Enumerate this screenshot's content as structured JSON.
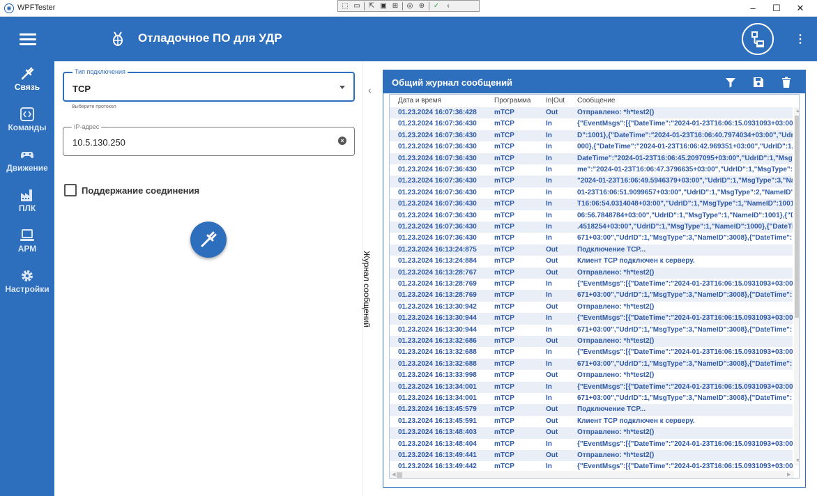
{
  "window": {
    "title": "WPFTester",
    "minimize": "–",
    "maximize": "☐",
    "close": "✕"
  },
  "debug_toolbar": {
    "icons": [
      "select-icon",
      "camera-icon",
      "pointer-icon",
      "box-icon",
      "layout-icon",
      "track-icon",
      "accessibility-icon",
      "check-icon",
      "collapse-icon"
    ]
  },
  "appbar": {
    "title": "Отладочное ПО для УДР",
    "more": "⋮"
  },
  "nav": [
    {
      "label": "Связь",
      "icon": "plug-icon",
      "active": true
    },
    {
      "label": "Команды",
      "icon": "code-icon"
    },
    {
      "label": "Движение",
      "icon": "gamepad-icon"
    },
    {
      "label": "ПЛК",
      "icon": "factory-icon"
    },
    {
      "label": "АРМ",
      "icon": "laptop-icon"
    },
    {
      "label": "Настройки",
      "icon": "gear-icon"
    }
  ],
  "connection": {
    "type_label": "Тип подключения",
    "type_value": "TCP",
    "type_hint": "Выберите протокол",
    "ip_label": "IP-адрес",
    "ip_value": "10.5.130.250",
    "keepalive_label": "Поддержание соединения",
    "keepalive_checked": false
  },
  "side_tab": {
    "label": "Журнал сообщений"
  },
  "log": {
    "title": "Общий журнал сообщений",
    "columns": [
      "Дата и время",
      "Программа",
      "In|Out",
      "Сообщение"
    ],
    "rows": [
      [
        "01.23.2024 16:07:36:428",
        "mTCP",
        "Out",
        "Отправлено: *h*test2()"
      ],
      [
        "01.23.2024 16:07:36:430",
        "mTCP",
        "In",
        "{\"EventMsgs\":[{\"DateTime\":\"2024-01-23T16:06:15.0931093+03:00\",\"U"
      ],
      [
        "01.23.2024 16:07:36:430",
        "mTCP",
        "In",
        "D\":1001},{\"DateTime\":\"2024-01-23T16:06:40.7974034+03:00\",\"UdrID\":"
      ],
      [
        "01.23.2024 16:07:36:430",
        "mTCP",
        "In",
        "000},{\"DateTime\":\"2024-01-23T16:06:42.969351+03:00\",\"UdrID\":1,\"Ms"
      ],
      [
        "01.23.2024 16:07:36:430",
        "mTCP",
        "In",
        "DateTime\":\"2024-01-23T16:06:45.2097095+03:00\",\"UdrID\":1,\"MsgTyp"
      ],
      [
        "01.23.2024 16:07:36:430",
        "mTCP",
        "In",
        "me\":\"2024-01-23T16:06:47.3796635+03:00\",\"UdrID\":1,\"MsgType\":4,\"N"
      ],
      [
        "01.23.2024 16:07:36:430",
        "mTCP",
        "In",
        "\"2024-01-23T16:06:49.5946379+03:00\",\"UdrID\":1,\"MsgType\":3,\"Name"
      ],
      [
        "01.23.2024 16:07:36:430",
        "mTCP",
        "In",
        "01-23T16:06:51.9099657+03:00\",\"UdrID\":1,\"MsgType\":2,\"NameID\":20"
      ],
      [
        "01.23.2024 16:07:36:430",
        "mTCP",
        "In",
        "T16:06:54.0314048+03:00\",\"UdrID\":1,\"MsgType\":1,\"NameID\":1001},{\""
      ],
      [
        "01.23.2024 16:07:36:430",
        "mTCP",
        "In",
        "06:56.7848784+03:00\",\"UdrID\":1,\"MsgType\":1,\"NameID\":1001},{\"Date"
      ],
      [
        "01.23.2024 16:07:36:430",
        "mTCP",
        "In",
        ".4518254+03:00\",\"UdrID\":1,\"MsgType\":1,\"NameID\":1000},{\"DateTime\""
      ],
      [
        "01.23.2024 16:07:36:430",
        "mTCP",
        "In",
        "671+03:00\",\"UdrID\":1,\"MsgType\":3,\"NameID\":3008},{\"DateTime\":\"2024"
      ],
      [
        "01.23.2024 16:13:24:875",
        "mTCP",
        "Out",
        "Подключение TCP..."
      ],
      [
        "01.23.2024 16:13:24:884",
        "mTCP",
        "Out",
        "Клиент TCP подключен к серверу."
      ],
      [
        "01.23.2024 16:13:28:767",
        "mTCP",
        "Out",
        "Отправлено: *h*test2()"
      ],
      [
        "01.23.2024 16:13:28:769",
        "mTCP",
        "In",
        "{\"EventMsgs\":[{\"DateTime\":\"2024-01-23T16:06:15.0931093+03:00\",\"U"
      ],
      [
        "01.23.2024 16:13:28:769",
        "mTCP",
        "In",
        "671+03:00\",\"UdrID\":1,\"MsgType\":3,\"NameID\":3008},{\"DateTime\":\"2024"
      ],
      [
        "01.23.2024 16:13:30:942",
        "mTCP",
        "Out",
        "Отправлено: *h*test2()"
      ],
      [
        "01.23.2024 16:13:30:944",
        "mTCP",
        "In",
        "{\"EventMsgs\":[{\"DateTime\":\"2024-01-23T16:06:15.0931093+03:00\",\"U"
      ],
      [
        "01.23.2024 16:13:30:944",
        "mTCP",
        "In",
        "671+03:00\",\"UdrID\":1,\"MsgType\":3,\"NameID\":3008},{\"DateTime\":\"2024"
      ],
      [
        "01.23.2024 16:13:32:686",
        "mTCP",
        "Out",
        "Отправлено: *h*test2()"
      ],
      [
        "01.23.2024 16:13:32:688",
        "mTCP",
        "In",
        "{\"EventMsgs\":[{\"DateTime\":\"2024-01-23T16:06:15.0931093+03:00\",\"U"
      ],
      [
        "01.23.2024 16:13:32:688",
        "mTCP",
        "In",
        "671+03:00\",\"UdrID\":1,\"MsgType\":3,\"NameID\":3008},{\"DateTime\":\"2024"
      ],
      [
        "01.23.2024 16:13:33:998",
        "mTCP",
        "Out",
        "Отправлено: *h*test2()"
      ],
      [
        "01.23.2024 16:13:34:001",
        "mTCP",
        "In",
        "{\"EventMsgs\":[{\"DateTime\":\"2024-01-23T16:06:15.0931093+03:00\",\"U"
      ],
      [
        "01.23.2024 16:13:34:001",
        "mTCP",
        "In",
        "671+03:00\",\"UdrID\":1,\"MsgType\":3,\"NameID\":3008},{\"DateTime\":\"2024"
      ],
      [
        "01.23.2024 16:13:45:579",
        "mTCP",
        "Out",
        "Подключение TCP..."
      ],
      [
        "01.23.2024 16:13:45:591",
        "mTCP",
        "Out",
        "Клиент TCP подключен к серверу."
      ],
      [
        "01.23.2024 16:13:48:403",
        "mTCP",
        "Out",
        "Отправлено: *h*test2()"
      ],
      [
        "01.23.2024 16:13:48:404",
        "mTCP",
        "In",
        "{\"EventMsgs\":[{\"DateTime\":\"2024-01-23T16:06:15.0931093+03:00\",\"U"
      ],
      [
        "01.23.2024 16:13:49:441",
        "mTCP",
        "Out",
        "Отправлено: *h*test2()"
      ],
      [
        "01.23.2024 16:13:49:442",
        "mTCP",
        "In",
        "{\"EventMsgs\":[{\"DateTime\":\"2024-01-23T16:06:15.0931093+03:00\",\"U"
      ]
    ]
  }
}
